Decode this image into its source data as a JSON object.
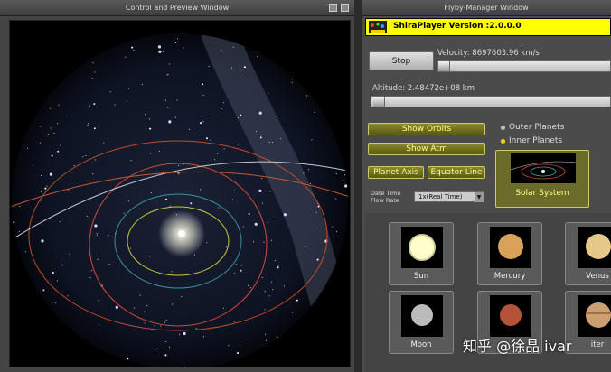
{
  "left_window": {
    "title": "Control and Preview Window"
  },
  "right_window": {
    "title": "Flyby-Manager Window"
  },
  "header": {
    "text": "ShiraPlayer Version :2.0.0.0"
  },
  "controls": {
    "stop_label": "Stop",
    "velocity_label": "Velocity: 8697603.96 km/s",
    "altitude_label": "Altitude: 2.48472e+08 km",
    "show_orbits_label": "Show Orbits",
    "show_atm_label": "Show Atm",
    "planet_axis_label": "Planet Axis",
    "equator_line_label": "Equator Line",
    "date_time_flow_label_1": "Date Time",
    "date_time_flow_label_2": "Flow Rate",
    "flow_rate_value": "1x(Real Time)",
    "outer_planets_label": "Outer Planets",
    "inner_planets_label": "Inner Planets",
    "selected_system": "Inner Planets",
    "solar_system_label": "Solar System"
  },
  "planets": [
    {
      "label": "Sun",
      "color": "#ffffcc"
    },
    {
      "label": "Mercury",
      "color": "#d9a25a"
    },
    {
      "label": "Venus",
      "color": "#e6c98a"
    },
    {
      "label": "Moon",
      "color": "#bbbbbb"
    },
    {
      "label": "",
      "color": "#b5533a"
    },
    {
      "label": "iter",
      "color": "#caa070"
    }
  ],
  "watermark": {
    "text": "知乎 @徐晶 ivar"
  }
}
